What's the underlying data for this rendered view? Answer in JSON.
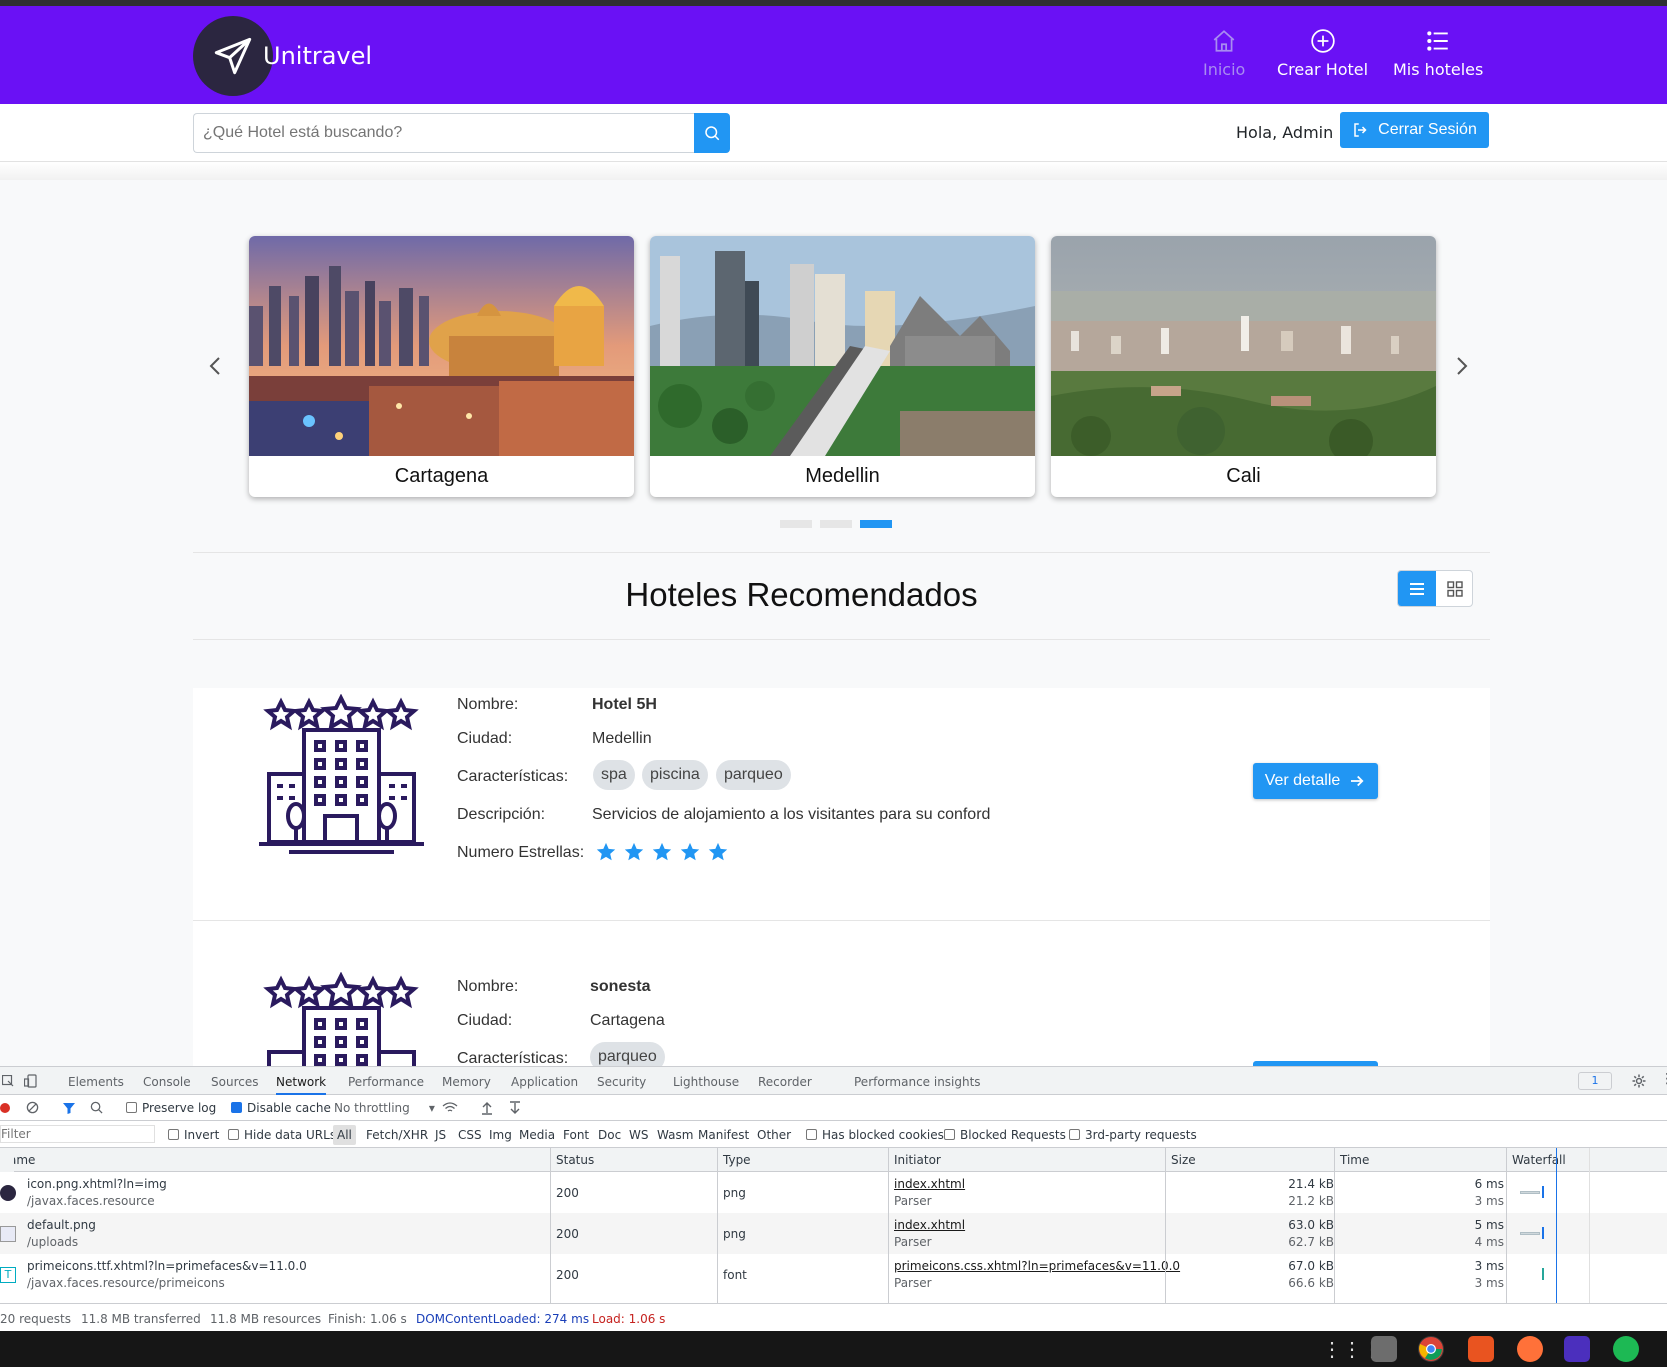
{
  "navbar": {
    "brand": "Unitravel",
    "items": [
      {
        "label": "Inicio",
        "icon": "home-icon",
        "active": true
      },
      {
        "label": "Crear Hotel",
        "icon": "plus-circle-icon",
        "active": false
      },
      {
        "label": "Mis hoteles",
        "icon": "list-icon",
        "active": false
      }
    ],
    "color": "#6a11f5"
  },
  "search": {
    "placeholder": "¿Qué Hotel está buscando?"
  },
  "user": {
    "greeting": "Hola, Admin",
    "logout_label": "Cerrar Sesión"
  },
  "carousel": {
    "cities": [
      {
        "name": "Cartagena"
      },
      {
        "name": "Medellin"
      },
      {
        "name": "Cali"
      }
    ],
    "active_dot": 3
  },
  "section": {
    "title": "Hoteles Recomendados"
  },
  "labels": {
    "nombre": "Nombre:",
    "ciudad": "Ciudad:",
    "caracteristicas": "Características:",
    "descripcion": "Descripción:",
    "estrellas": "Numero Estrellas:",
    "detail_button": "Ver detalle"
  },
  "hotels": [
    {
      "name": "Hotel 5H",
      "city": "Medellin",
      "features": [
        "spa",
        "piscina",
        "parqueo"
      ],
      "description": "Servicios de alojamiento a los visitantes para su conford",
      "stars": 5
    },
    {
      "name": "sonesta",
      "city": "Cartagena",
      "features": [
        "parqueo"
      ]
    }
  ],
  "devtools": {
    "tabs": [
      "Elements",
      "Console",
      "Sources",
      "Network",
      "Performance",
      "Memory",
      "Application",
      "Security",
      "Lighthouse",
      "Recorder",
      "Performance insights"
    ],
    "active_tab": "Network",
    "issues_count": "1",
    "preserve_log": "Preserve log",
    "disable_cache": "Disable cache",
    "throttling": "No throttling",
    "filter_placeholder": "Filter",
    "invert": "Invert",
    "hide_data_urls": "Hide data URLs",
    "type_filters": [
      "All",
      "Fetch/XHR",
      "JS",
      "CSS",
      "Img",
      "Media",
      "Font",
      "Doc",
      "WS",
      "Wasm",
      "Manifest",
      "Other"
    ],
    "has_blocked_cookies": "Has blocked cookies",
    "blocked_requests": "Blocked Requests",
    "third_party": "3rd-party requests",
    "columns": [
      "Name",
      "Status",
      "Type",
      "Initiator",
      "Size",
      "Time",
      "Waterfall"
    ],
    "rows": [
      {
        "name": "icon.png.xhtml?ln=img",
        "path": "/javax.faces.resource",
        "status": "200",
        "type": "png",
        "initiator": "index.xhtml",
        "initiator_sub": "Parser",
        "size": "21.4 kB",
        "size_sub": "21.2 kB",
        "time": "6 ms",
        "time_sub": "3 ms"
      },
      {
        "name": "default.png",
        "path": "/uploads",
        "status": "200",
        "type": "png",
        "initiator": "index.xhtml",
        "initiator_sub": "Parser",
        "size": "63.0 kB",
        "size_sub": "62.7 kB",
        "time": "5 ms",
        "time_sub": "4 ms"
      },
      {
        "name": "primeicons.ttf.xhtml?ln=primefaces&v=11.0.0",
        "path": "/javax.faces.resource/primeicons",
        "status": "200",
        "type": "font",
        "initiator": "primeicons.css.xhtml?ln=primefaces&v=11.0.0",
        "initiator_sub": "Parser",
        "size": "67.0 kB",
        "size_sub": "66.6 kB",
        "time": "3 ms",
        "time_sub": "3 ms"
      }
    ],
    "status": {
      "requests": "20 requests",
      "transferred": "11.8 MB transferred",
      "resources": "11.8 MB resources",
      "finish": "Finish: 1.06 s",
      "dcl": "DOMContentLoaded: 274 ms",
      "load": "Load: 1.06 s"
    }
  }
}
